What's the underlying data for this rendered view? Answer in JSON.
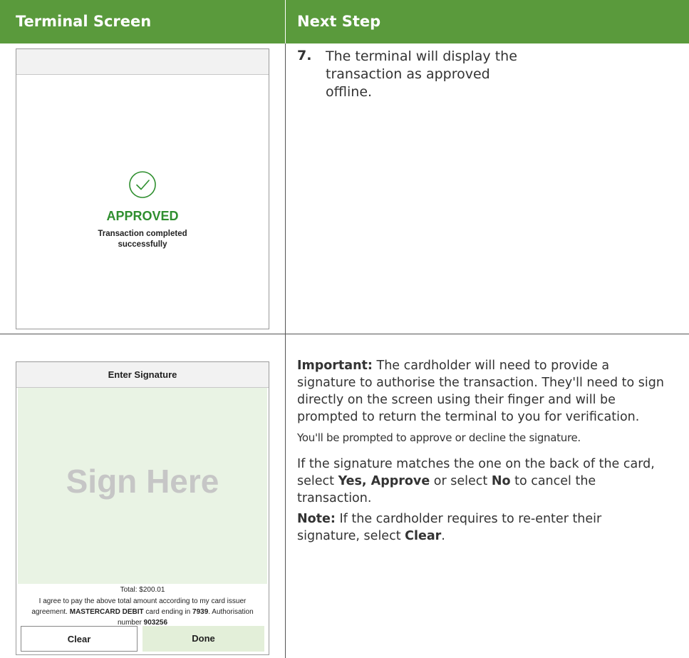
{
  "header": {
    "left": "Terminal Screen",
    "right": "Next Step"
  },
  "terminal_approved": {
    "status": "APPROVED",
    "message_line1": "Transaction completed",
    "message_line2": "successfully",
    "icon": "check-circle-icon",
    "accent_color": "#2f8f2f"
  },
  "step7": {
    "number": "7.",
    "text": "The terminal will display the transaction as approved offline."
  },
  "terminal_signature": {
    "title": "Enter Signature",
    "placeholder": "Sign Here",
    "total": "Total: $200.01",
    "agree_1": "I agree to pay the above total amount according to my card issuer agreement.",
    "card_type": "MASTERCARD DEBIT",
    "agree_2": "card ending in",
    "card_last4": "7939",
    "agree_3": ". Authorisation number",
    "auth_number": "903256",
    "clear_label": "Clear",
    "done_label": "Done"
  },
  "instructions": {
    "important_label": "Important:",
    "important_text": "The cardholder will need to provide a signature to authorise the transaction. They'll need to sign directly on the screen using their finger and will be prompted to return the terminal to you for verification.",
    "prompt_text": "You'll be prompted to approve or decline the signature.",
    "match_1": "If the signature matches the one on the back of the card, select",
    "yes_label": "Yes, Approve",
    "match_2": "or select",
    "no_label": "No",
    "match_3": "to cancel the transaction.",
    "note_label": "Note:",
    "note_text": "If the cardholder requires to re-enter their signature, select",
    "clear_label": "Clear",
    "note_end": "."
  },
  "colors": {
    "header_bg": "#5a9a3c",
    "sign_area_bg": "#e9f3e4",
    "done_bg": "#e3efd9"
  }
}
